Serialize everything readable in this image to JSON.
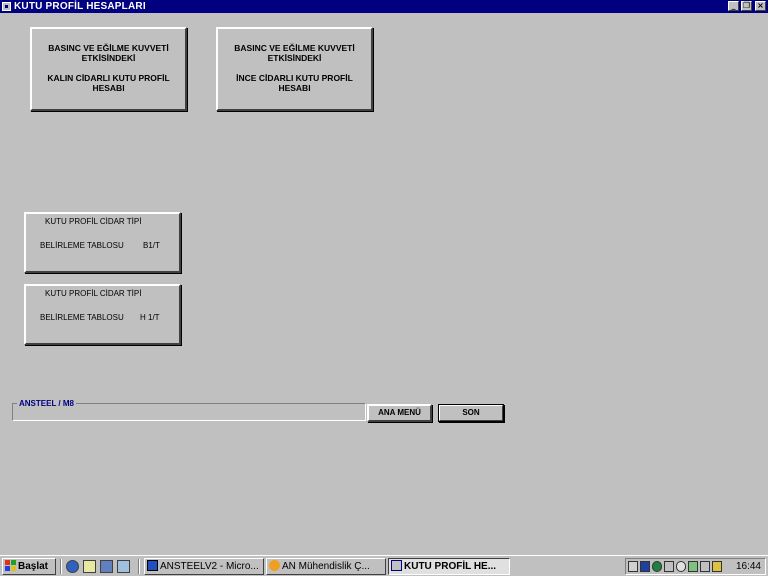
{
  "window": {
    "title": "KUTU PROFİL HESAPLARI",
    "icon": "app-window-icon",
    "controls": {
      "minimize": "_",
      "maximize": "❐",
      "close": "×"
    }
  },
  "buttons": {
    "thick": {
      "line1": "BASINC VE EĞİLME   KUVVETİ",
      "line2": "ETKİSİNDEKİ",
      "line3": "KALIN CİDARLI    KUTU PROFİL",
      "line4": "HESABI"
    },
    "thin": {
      "line1": "BASINC VE EĞİLME   KUVVETİ",
      "line2": "ETKİSİNDEKİ",
      "line3": "İNCE CİDARLI    KUTU PROFİL",
      "line4": "HESABI"
    },
    "table_b1": {
      "line1": "KUTU  PROFİL CİDAR TİPİ",
      "line2": "BELİRLEME TABLOSU",
      "code": "B1/T"
    },
    "table_h1": {
      "line1": "KUTU  PROFİL CİDAR TİPİ",
      "line2": "BELİRLEME TABLOSU",
      "code": "H 1/T"
    }
  },
  "frame": {
    "label": "ANSTEEL  / M8"
  },
  "actions": {
    "main_menu": "ANA MENÜ",
    "end": "SON"
  },
  "taskbar": {
    "start": "Başlat",
    "quick_launch_icons": [
      "ie-icon",
      "outlook-express-icon",
      "desktop-icon",
      "channels-icon"
    ],
    "tasks": [
      {
        "label": "ANSTEELV2 - Micro...",
        "icon": "word-icon",
        "active": false
      },
      {
        "label": "AN Mühendislik    Ç...",
        "icon": "sun-icon",
        "active": false
      },
      {
        "label": "KUTU PROFİL HE...",
        "icon": "app-window-icon",
        "active": true
      }
    ],
    "clock": "16:44"
  },
  "colors": {
    "face": "#c0c0c0",
    "titlebar": "#000080",
    "frame_label": "#000080"
  }
}
